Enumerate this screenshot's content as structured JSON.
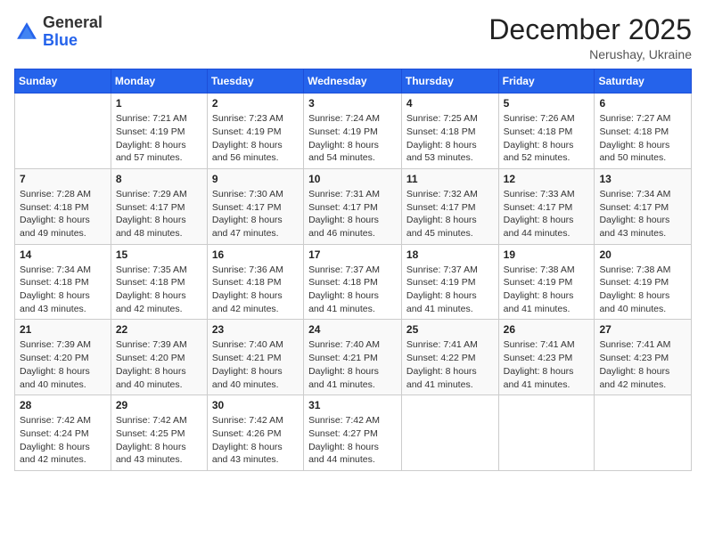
{
  "logo": {
    "general": "General",
    "blue": "Blue"
  },
  "title": "December 2025",
  "location": "Nerushay, Ukraine",
  "days_header": [
    "Sunday",
    "Monday",
    "Tuesday",
    "Wednesday",
    "Thursday",
    "Friday",
    "Saturday"
  ],
  "weeks": [
    [
      {
        "day": "",
        "sunrise": "",
        "sunset": "",
        "daylight": ""
      },
      {
        "day": "1",
        "sunrise": "Sunrise: 7:21 AM",
        "sunset": "Sunset: 4:19 PM",
        "daylight": "Daylight: 8 hours and 57 minutes."
      },
      {
        "day": "2",
        "sunrise": "Sunrise: 7:23 AM",
        "sunset": "Sunset: 4:19 PM",
        "daylight": "Daylight: 8 hours and 56 minutes."
      },
      {
        "day": "3",
        "sunrise": "Sunrise: 7:24 AM",
        "sunset": "Sunset: 4:19 PM",
        "daylight": "Daylight: 8 hours and 54 minutes."
      },
      {
        "day": "4",
        "sunrise": "Sunrise: 7:25 AM",
        "sunset": "Sunset: 4:18 PM",
        "daylight": "Daylight: 8 hours and 53 minutes."
      },
      {
        "day": "5",
        "sunrise": "Sunrise: 7:26 AM",
        "sunset": "Sunset: 4:18 PM",
        "daylight": "Daylight: 8 hours and 52 minutes."
      },
      {
        "day": "6",
        "sunrise": "Sunrise: 7:27 AM",
        "sunset": "Sunset: 4:18 PM",
        "daylight": "Daylight: 8 hours and 50 minutes."
      }
    ],
    [
      {
        "day": "7",
        "sunrise": "Sunrise: 7:28 AM",
        "sunset": "Sunset: 4:18 PM",
        "daylight": "Daylight: 8 hours and 49 minutes."
      },
      {
        "day": "8",
        "sunrise": "Sunrise: 7:29 AM",
        "sunset": "Sunset: 4:17 PM",
        "daylight": "Daylight: 8 hours and 48 minutes."
      },
      {
        "day": "9",
        "sunrise": "Sunrise: 7:30 AM",
        "sunset": "Sunset: 4:17 PM",
        "daylight": "Daylight: 8 hours and 47 minutes."
      },
      {
        "day": "10",
        "sunrise": "Sunrise: 7:31 AM",
        "sunset": "Sunset: 4:17 PM",
        "daylight": "Daylight: 8 hours and 46 minutes."
      },
      {
        "day": "11",
        "sunrise": "Sunrise: 7:32 AM",
        "sunset": "Sunset: 4:17 PM",
        "daylight": "Daylight: 8 hours and 45 minutes."
      },
      {
        "day": "12",
        "sunrise": "Sunrise: 7:33 AM",
        "sunset": "Sunset: 4:17 PM",
        "daylight": "Daylight: 8 hours and 44 minutes."
      },
      {
        "day": "13",
        "sunrise": "Sunrise: 7:34 AM",
        "sunset": "Sunset: 4:17 PM",
        "daylight": "Daylight: 8 hours and 43 minutes."
      }
    ],
    [
      {
        "day": "14",
        "sunrise": "Sunrise: 7:34 AM",
        "sunset": "Sunset: 4:18 PM",
        "daylight": "Daylight: 8 hours and 43 minutes."
      },
      {
        "day": "15",
        "sunrise": "Sunrise: 7:35 AM",
        "sunset": "Sunset: 4:18 PM",
        "daylight": "Daylight: 8 hours and 42 minutes."
      },
      {
        "day": "16",
        "sunrise": "Sunrise: 7:36 AM",
        "sunset": "Sunset: 4:18 PM",
        "daylight": "Daylight: 8 hours and 42 minutes."
      },
      {
        "day": "17",
        "sunrise": "Sunrise: 7:37 AM",
        "sunset": "Sunset: 4:18 PM",
        "daylight": "Daylight: 8 hours and 41 minutes."
      },
      {
        "day": "18",
        "sunrise": "Sunrise: 7:37 AM",
        "sunset": "Sunset: 4:19 PM",
        "daylight": "Daylight: 8 hours and 41 minutes."
      },
      {
        "day": "19",
        "sunrise": "Sunrise: 7:38 AM",
        "sunset": "Sunset: 4:19 PM",
        "daylight": "Daylight: 8 hours and 41 minutes."
      },
      {
        "day": "20",
        "sunrise": "Sunrise: 7:38 AM",
        "sunset": "Sunset: 4:19 PM",
        "daylight": "Daylight: 8 hours and 40 minutes."
      }
    ],
    [
      {
        "day": "21",
        "sunrise": "Sunrise: 7:39 AM",
        "sunset": "Sunset: 4:20 PM",
        "daylight": "Daylight: 8 hours and 40 minutes."
      },
      {
        "day": "22",
        "sunrise": "Sunrise: 7:39 AM",
        "sunset": "Sunset: 4:20 PM",
        "daylight": "Daylight: 8 hours and 40 minutes."
      },
      {
        "day": "23",
        "sunrise": "Sunrise: 7:40 AM",
        "sunset": "Sunset: 4:21 PM",
        "daylight": "Daylight: 8 hours and 40 minutes."
      },
      {
        "day": "24",
        "sunrise": "Sunrise: 7:40 AM",
        "sunset": "Sunset: 4:21 PM",
        "daylight": "Daylight: 8 hours and 41 minutes."
      },
      {
        "day": "25",
        "sunrise": "Sunrise: 7:41 AM",
        "sunset": "Sunset: 4:22 PM",
        "daylight": "Daylight: 8 hours and 41 minutes."
      },
      {
        "day": "26",
        "sunrise": "Sunrise: 7:41 AM",
        "sunset": "Sunset: 4:23 PM",
        "daylight": "Daylight: 8 hours and 41 minutes."
      },
      {
        "day": "27",
        "sunrise": "Sunrise: 7:41 AM",
        "sunset": "Sunset: 4:23 PM",
        "daylight": "Daylight: 8 hours and 42 minutes."
      }
    ],
    [
      {
        "day": "28",
        "sunrise": "Sunrise: 7:42 AM",
        "sunset": "Sunset: 4:24 PM",
        "daylight": "Daylight: 8 hours and 42 minutes."
      },
      {
        "day": "29",
        "sunrise": "Sunrise: 7:42 AM",
        "sunset": "Sunset: 4:25 PM",
        "daylight": "Daylight: 8 hours and 43 minutes."
      },
      {
        "day": "30",
        "sunrise": "Sunrise: 7:42 AM",
        "sunset": "Sunset: 4:26 PM",
        "daylight": "Daylight: 8 hours and 43 minutes."
      },
      {
        "day": "31",
        "sunrise": "Sunrise: 7:42 AM",
        "sunset": "Sunset: 4:27 PM",
        "daylight": "Daylight: 8 hours and 44 minutes."
      },
      {
        "day": "",
        "sunrise": "",
        "sunset": "",
        "daylight": ""
      },
      {
        "day": "",
        "sunrise": "",
        "sunset": "",
        "daylight": ""
      },
      {
        "day": "",
        "sunrise": "",
        "sunset": "",
        "daylight": ""
      }
    ]
  ]
}
